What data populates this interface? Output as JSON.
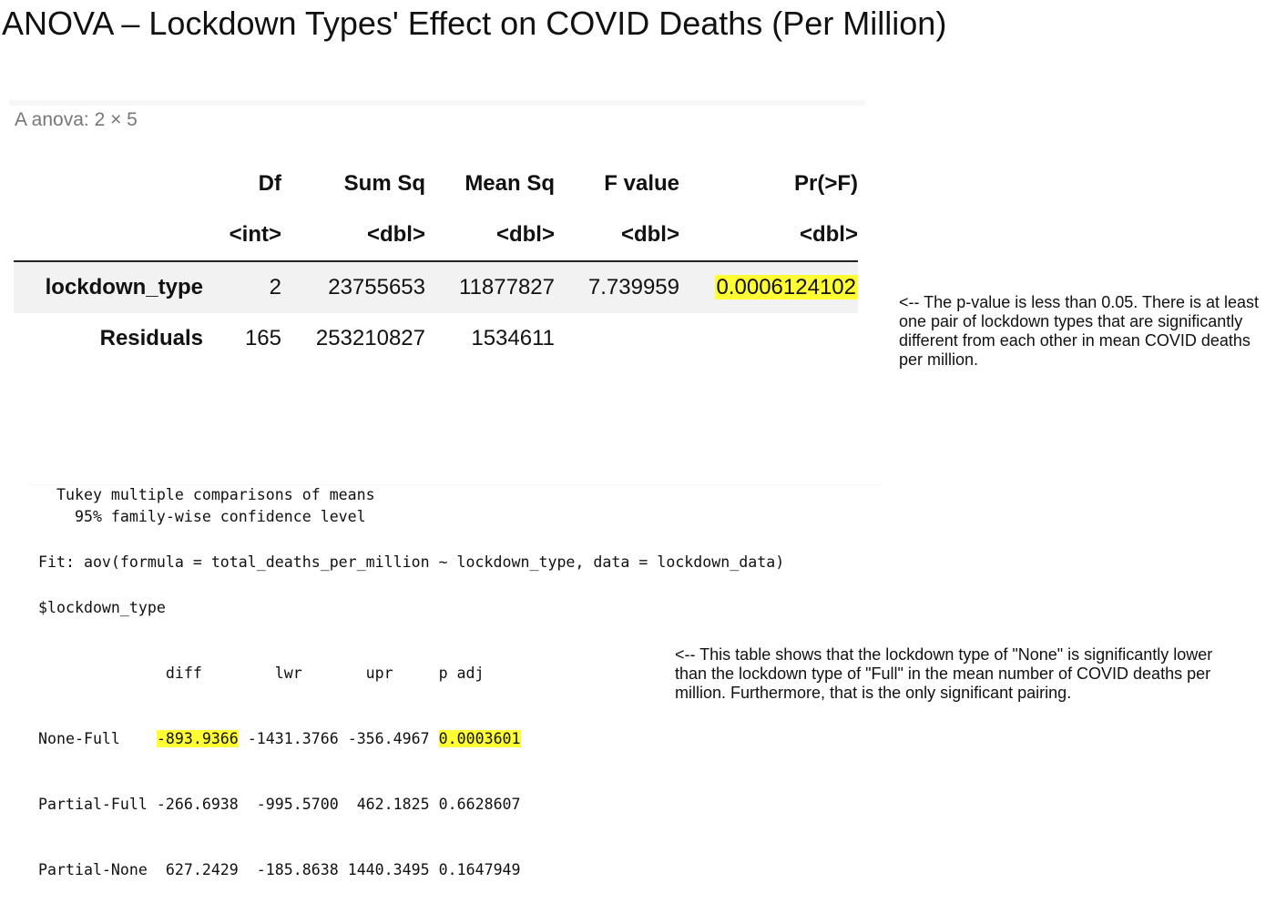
{
  "title": "ANOVA – Lockdown Types' Effect on COVID Deaths (Per Million)",
  "anova": {
    "caption": "A anova: 2 × 5",
    "columns": [
      "Df",
      "Sum Sq",
      "Mean Sq",
      "F value",
      "Pr(>F)"
    ],
    "types": [
      "<int>",
      "<dbl>",
      "<dbl>",
      "<dbl>",
      "<dbl>"
    ],
    "rows": [
      {
        "label": "lockdown_type",
        "df": "2",
        "sum_sq": "23755653",
        "mean_sq": "11877827",
        "f_value": "7.739959",
        "p_value": "0.0006124102"
      },
      {
        "label": "Residuals",
        "df": "165",
        "sum_sq": "253210827",
        "mean_sq": "1534611",
        "f_value": "",
        "p_value": ""
      }
    ],
    "note": "<-- The p-value is less than 0.05.  There is at least one pair of lockdown types that are significantly different from each other in mean COVID deaths per million."
  },
  "tukey": {
    "heading1": "  Tukey multiple comparisons of means",
    "heading2": "    95% family-wise confidence level",
    "fit": "Fit: aov(formula = total_deaths_per_million ~ lockdown_type, data = lockdown_data)",
    "term": "$lockdown_type",
    "header": "              diff        lwr       upr     p adj",
    "rows": [
      {
        "label": "None-Full    ",
        "diff": "-893.9366",
        "lwr": "-1431.3766",
        "upr": "-356.4967",
        "padj": "0.0003601"
      },
      {
        "label": "Partial-Full ",
        "diff": "-266.6938",
        "lwr": " -995.5700",
        "upr": " 462.1825",
        "padj": "0.6628607"
      },
      {
        "label": "Partial-None ",
        "diff": " 627.2429",
        "lwr": " -185.8638",
        "upr": "1440.3495",
        "padj": "0.1647949"
      }
    ],
    "note": "<-- This table shows that the lockdown type of \"None\" is significantly lower than the lockdown type of \"Full\" in the mean number of COVID deaths per million.  Furthermore, that is the only significant pairing."
  },
  "colors": {
    "highlight": "#ffff33",
    "row_shade": "#f2f2f2",
    "caption_gray": "#777777"
  }
}
